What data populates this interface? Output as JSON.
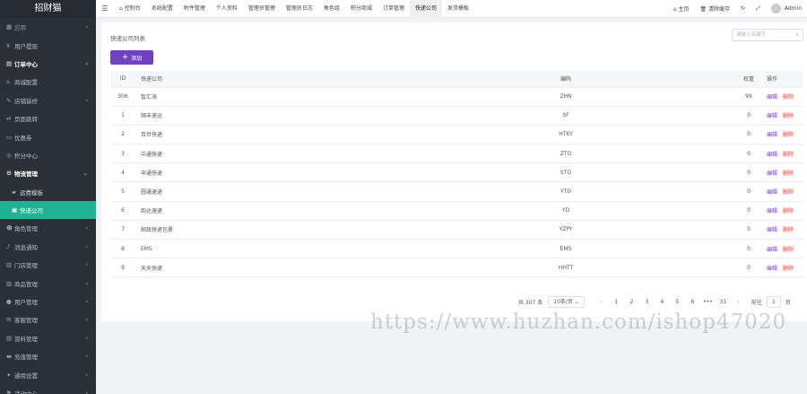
{
  "brand": "招财猫",
  "sidebar": {
    "items": [
      {
        "label": "应用",
        "icon": "grid-icon",
        "arrow": "‹",
        "style": "dim"
      },
      {
        "label": "用户提现",
        "icon": "wallet-icon",
        "arrow": "",
        "style": ""
      },
      {
        "label": "订单中心",
        "icon": "doc-icon",
        "arrow": "‹",
        "style": "bold"
      },
      {
        "label": "商城配置",
        "icon": "shop-icon",
        "arrow": "",
        "style": ""
      },
      {
        "label": "店铺装修",
        "icon": "brush-icon",
        "arrow": "‹",
        "style": ""
      },
      {
        "label": "页面跳转",
        "icon": "link-icon",
        "arrow": "",
        "style": ""
      },
      {
        "label": "优惠券",
        "icon": "coupon-icon",
        "arrow": "",
        "style": ""
      },
      {
        "label": "积分中心",
        "icon": "points-icon",
        "arrow": "",
        "style": ""
      },
      {
        "label": "物流管理",
        "icon": "cog-icon",
        "arrow": "⌄",
        "style": "bold"
      },
      {
        "label": "运费模板",
        "icon": "truck-icon",
        "arrow": "",
        "style": "sub"
      },
      {
        "label": "快递公司",
        "icon": "car-icon",
        "arrow": "",
        "style": "sub active"
      },
      {
        "label": "角色管理",
        "icon": "users-icon",
        "arrow": "‹",
        "style": ""
      },
      {
        "label": "消息通知",
        "icon": "bell-icon",
        "arrow": "‹",
        "style": ""
      },
      {
        "label": "门店管理",
        "icon": "store-icon",
        "arrow": "‹",
        "style": ""
      },
      {
        "label": "商品管理",
        "icon": "box-icon",
        "arrow": "‹",
        "style": ""
      },
      {
        "label": "用户管理",
        "icon": "user-icon",
        "arrow": "‹",
        "style": ""
      },
      {
        "label": "客服管理",
        "icon": "chat-icon",
        "arrow": "‹",
        "style": ""
      },
      {
        "label": "资料管理",
        "icon": "file-icon",
        "arrow": "‹",
        "style": ""
      },
      {
        "label": "充值管理",
        "icon": "card-icon",
        "arrow": "‹",
        "style": ""
      },
      {
        "label": "通用设置",
        "icon": "settings-icon",
        "arrow": "‹",
        "style": ""
      },
      {
        "label": "活动中心",
        "icon": "flag-icon",
        "arrow": "‹",
        "style": ""
      }
    ]
  },
  "topbar": {
    "tabs": [
      {
        "label": "控制台",
        "icon": "home-icon",
        "active": false
      },
      {
        "label": "系统配置",
        "active": false
      },
      {
        "label": "附件管理",
        "active": false
      },
      {
        "label": "个人资料",
        "active": false
      },
      {
        "label": "管理员管理",
        "active": false
      },
      {
        "label": "管理员日志",
        "active": false
      },
      {
        "label": "角色组",
        "active": false
      },
      {
        "label": "积分商城",
        "active": false
      },
      {
        "label": "订单管理",
        "active": false
      },
      {
        "label": "快递公司",
        "active": true
      },
      {
        "label": "发货模板",
        "active": false
      }
    ],
    "home_label": "主页",
    "clear_cache_label": "清除缓存",
    "user_name": "Admin"
  },
  "page": {
    "title": "快递公司列表",
    "search_placeholder": "请输入关键字",
    "add_label": "添加",
    "columns": {
      "id": "ID",
      "name": "快递公司",
      "code": "编码",
      "sort": "权重",
      "ops": "操作"
    },
    "edit_label": "编辑",
    "delete_label": "删除",
    "rows": [
      {
        "id": "306",
        "name": "智汇海",
        "code": "ZHN",
        "sort": "99"
      },
      {
        "id": "1",
        "name": "顺丰速运",
        "code": "SF",
        "sort": "0"
      },
      {
        "id": "2",
        "name": "百世快递",
        "code": "HTKY",
        "sort": "0"
      },
      {
        "id": "3",
        "name": "中通快递",
        "code": "ZTO",
        "sort": "0"
      },
      {
        "id": "4",
        "name": "申通快递",
        "code": "STO",
        "sort": "0"
      },
      {
        "id": "5",
        "name": "圆通速递",
        "code": "YTO",
        "sort": "0"
      },
      {
        "id": "6",
        "name": "韵达速递",
        "code": "YD",
        "sort": "0"
      },
      {
        "id": "7",
        "name": "邮政快递包裹",
        "code": "YZPY",
        "sort": "0"
      },
      {
        "id": "8",
        "name": "EMS",
        "code": "EMS",
        "sort": "0"
      },
      {
        "id": "9",
        "name": "天天快递",
        "code": "HHTT",
        "sort": "0"
      }
    ]
  },
  "pagination": {
    "total": "共 307 条",
    "page_size": "10条/页",
    "pages": [
      "1",
      "2",
      "3",
      "4",
      "5",
      "6",
      "•••",
      "31"
    ],
    "goto_label": "前往",
    "goto_value": "1",
    "page_unit": "页"
  },
  "watermark": "https://www.huzhan.com/ishop47020",
  "colors": {
    "accent": "#6f42c1",
    "active_nav": "#1fb393",
    "danger": "#e53935",
    "sidebar": "#2b3036"
  }
}
